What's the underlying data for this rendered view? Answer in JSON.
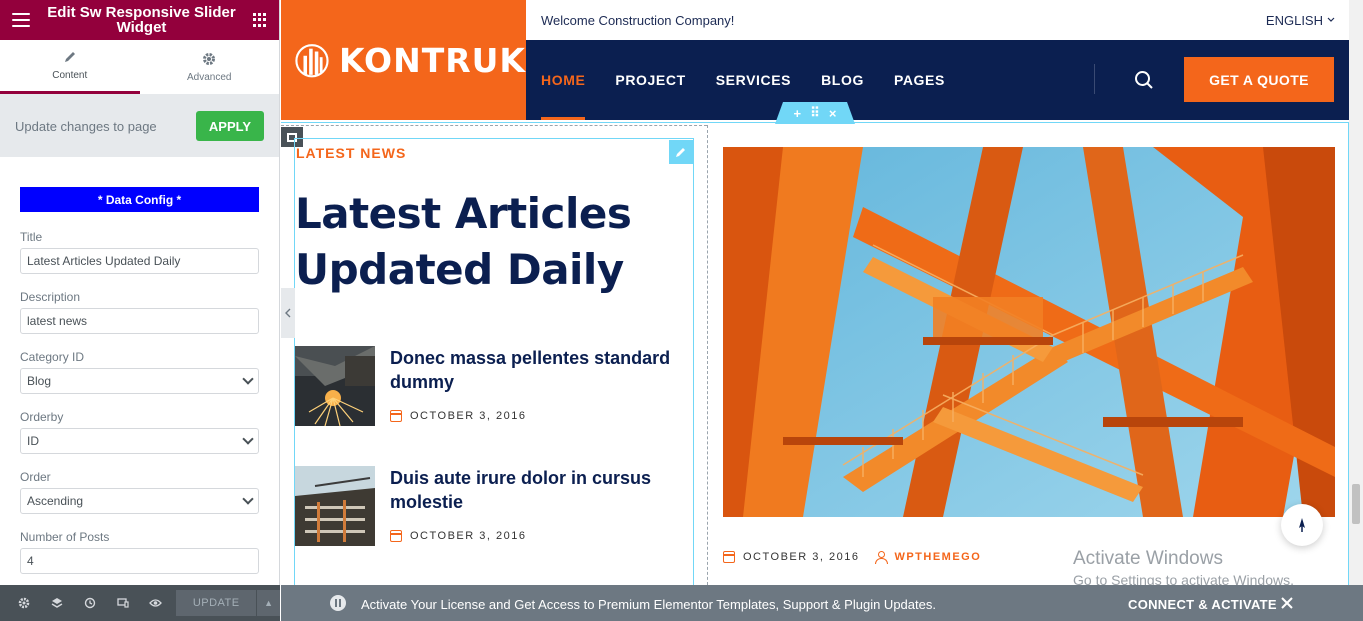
{
  "editor": {
    "title": "Edit Sw Responsive Slider Widget",
    "tabs": [
      {
        "label": "Content",
        "icon": "pencil-icon"
      },
      {
        "label": "Advanced",
        "icon": "gear-icon"
      }
    ],
    "apply_text": "Update changes to page",
    "apply_label": "APPLY",
    "section_title": "* Data Config *",
    "fields": {
      "title": {
        "label": "Title",
        "value": "Latest Articles Updated Daily"
      },
      "description": {
        "label": "Description",
        "value": "latest news"
      },
      "category": {
        "label": "Category ID",
        "value": "Blog"
      },
      "orderby": {
        "label": "Orderby",
        "value": "ID"
      },
      "order": {
        "label": "Order",
        "value": "Ascending"
      },
      "posts": {
        "label": "Number of Posts",
        "value": "4"
      }
    },
    "update_label": "UPDATE"
  },
  "site": {
    "logo": "KONTRUK",
    "welcome": "Welcome Construction Company!",
    "language": "ENGLISH",
    "nav": [
      "HOME",
      "PROJECT",
      "SERVICES",
      "BLOG",
      "PAGES"
    ],
    "quote_label": "GET A QUOTE",
    "latest_label": "LATEST NEWS",
    "latest_title_l1": "Latest Articles",
    "latest_title_l2": "Updated Daily",
    "posts": [
      {
        "title": "Donec massa pellentes standard dummy",
        "date": "OCTOBER 3, 2016"
      },
      {
        "title": "Duis aute irure dolor in cursus molestie",
        "date": "OCTOBER 3, 2016"
      }
    ],
    "featured": {
      "date": "OCTOBER 3, 2016",
      "author": "WPTHEMEGO"
    },
    "watermark_l1": "Activate Windows",
    "watermark_l2": "Go to Settings to activate Windows."
  },
  "license": {
    "message": "Activate Your License and Get Access to Premium Elementor Templates, Support & Plugin Updates.",
    "cta": "CONNECT & ACTIVATE"
  },
  "colors": {
    "brand_orange": "#f4661b",
    "navy": "#0b1f50",
    "editor_maroon": "#93003c",
    "apply_green": "#39b54a"
  }
}
